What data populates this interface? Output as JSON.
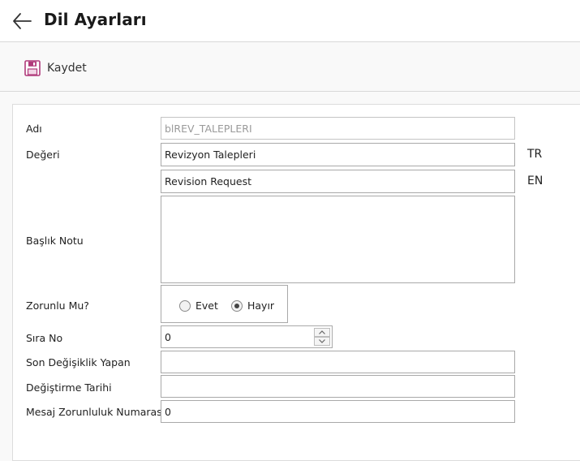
{
  "header": {
    "title": "Dil Ayarları",
    "back_icon": "arrow-left-icon"
  },
  "toolbar": {
    "save_label": "Kaydet",
    "save_icon": "floppy-disk-icon",
    "save_icon_color": "#b03a7a"
  },
  "form": {
    "name": {
      "label": "Adı",
      "value": "blREV_TALEPLERI"
    },
    "value": {
      "label": "Değeri",
      "tr": {
        "value": "Revizyon Talepleri",
        "lang": "TR"
      },
      "en": {
        "value": "Revision Request",
        "lang": "EN"
      }
    },
    "title_note": {
      "label": "Başlık Notu",
      "value": ""
    },
    "required": {
      "label": "Zorunlu Mu?",
      "options": [
        {
          "label": "Evet",
          "checked": false
        },
        {
          "label": "Hayır",
          "checked": true
        }
      ]
    },
    "order_no": {
      "label": "Sıra No",
      "value": "0"
    },
    "last_modified_by": {
      "label": "Son Değişiklik Yapan",
      "value": ""
    },
    "modified_date": {
      "label": "Değiştirme Tarihi",
      "value": ""
    },
    "message_required_no": {
      "label": "Mesaj Zorunluluk Numarası",
      "value": "0"
    }
  }
}
